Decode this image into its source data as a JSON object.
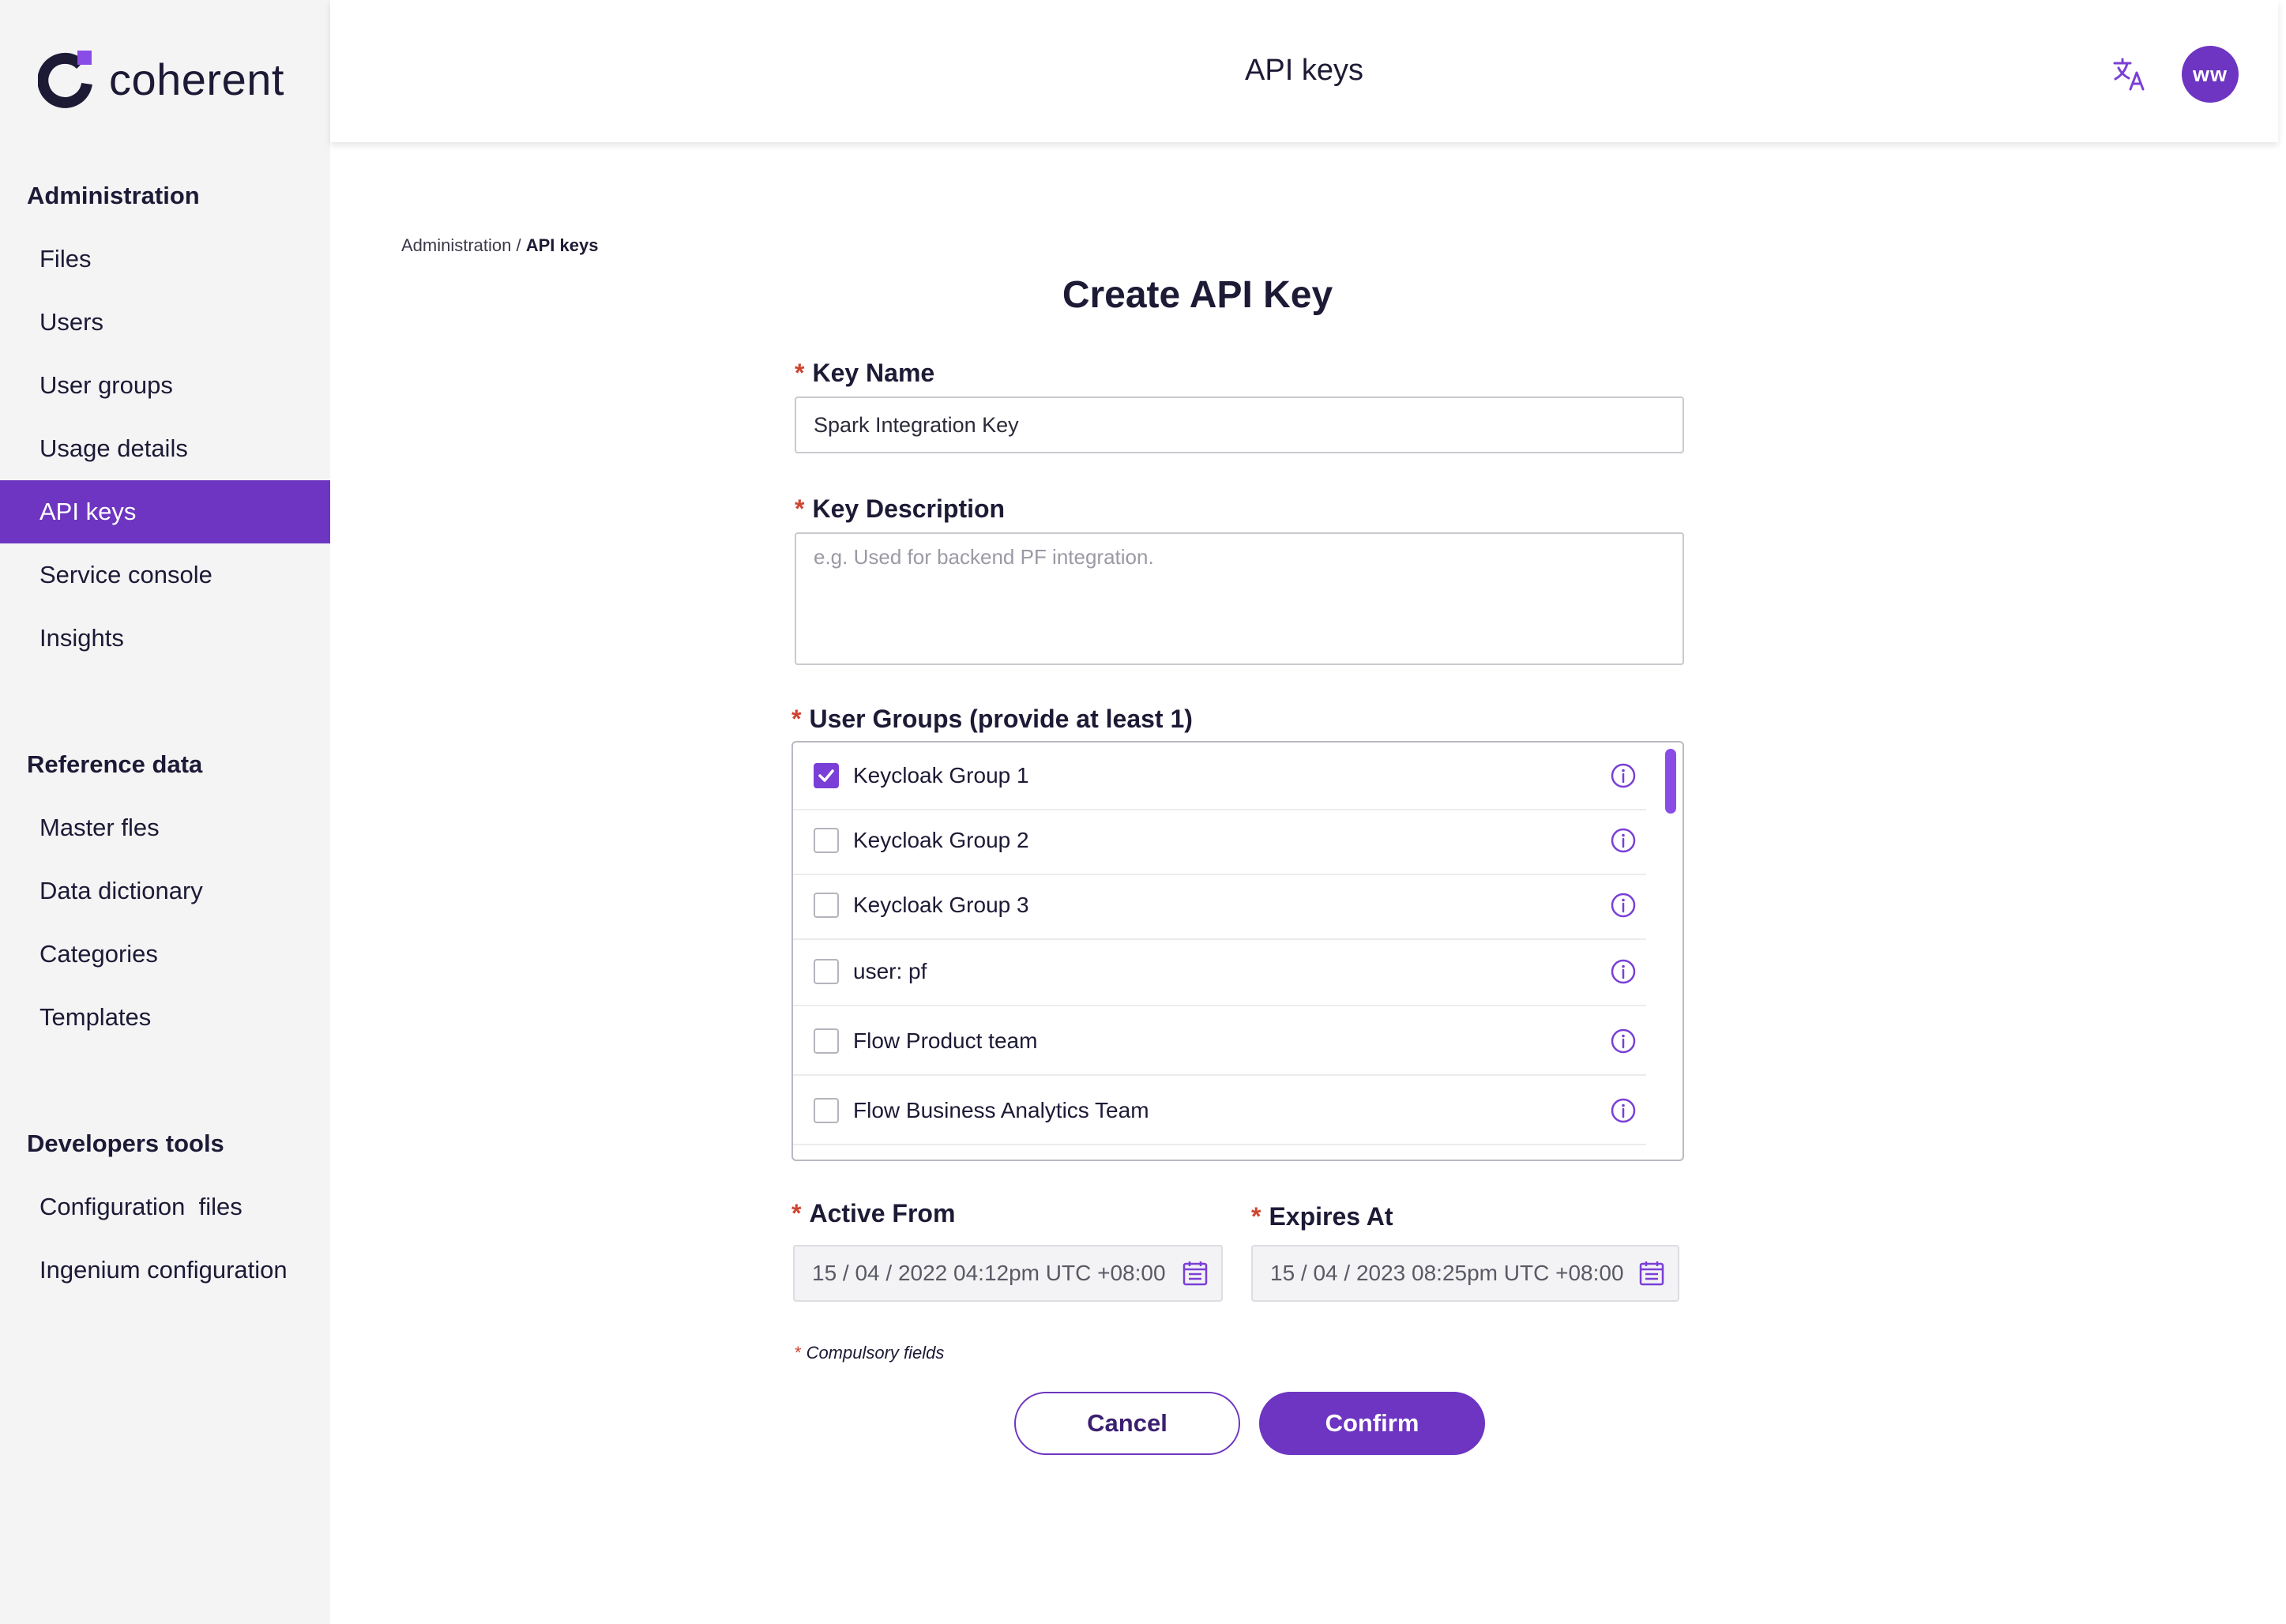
{
  "brand": {
    "name": "coherent",
    "accent": "#6d35c1",
    "logo_dot": "#8a4ce6"
  },
  "header": {
    "title": "API keys",
    "avatar_initials": "ww",
    "translate_icon": "translate-icon"
  },
  "sidebar": {
    "sections": [
      {
        "title": "Administration",
        "items": [
          "Files",
          "Users",
          "User groups",
          "Usage details",
          "API keys",
          "Service console",
          "Insights"
        ]
      },
      {
        "title": "Reference data",
        "items": [
          "Master fles",
          "Data dictionary",
          "Categories",
          "Templates"
        ]
      },
      {
        "title": "Developers tools",
        "items": [
          "Configuration  files",
          "Ingenium configuration"
        ]
      }
    ],
    "active_item": "API keys"
  },
  "breadcrumb": {
    "parent": "Administration /",
    "current": "API keys"
  },
  "form": {
    "title": "Create API Key",
    "required_marker": "*",
    "key_name": {
      "label": "Key Name",
      "value": "Spark Integration Key"
    },
    "key_description": {
      "label": "Key Description",
      "placeholder": "e.g. Used for backend PF integration."
    },
    "user_groups": {
      "label": "User Groups (provide at least 1)",
      "items": [
        {
          "label": "Keycloak Group 1",
          "checked": true
        },
        {
          "label": "Keycloak Group 2",
          "checked": false
        },
        {
          "label": "Keycloak Group 3",
          "checked": false
        },
        {
          "label": "user: pf",
          "checked": false
        },
        {
          "label": "Flow Product team",
          "checked": false
        },
        {
          "label": "Flow Business Analytics Team",
          "checked": false
        }
      ]
    },
    "active_from": {
      "label": "Active From",
      "value": "15 / 04 / 2022 04:12pm UTC +08:00"
    },
    "expires_at": {
      "label": "Expires At",
      "value": "15 / 04 / 2023 08:25pm UTC +08:00"
    },
    "compulsory_note": "Compulsory fields",
    "cancel_label": "Cancel",
    "confirm_label": "Confirm"
  }
}
